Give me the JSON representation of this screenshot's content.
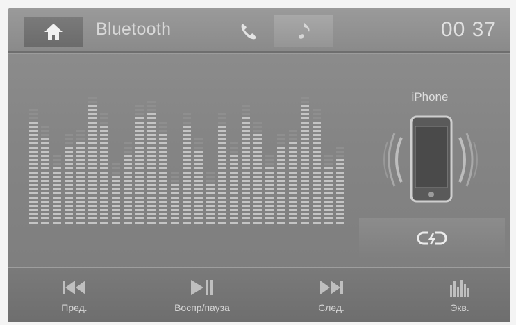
{
  "header": {
    "home_icon": "home-icon",
    "title": "Bluetooth",
    "tabs": [
      {
        "icon": "phone-icon",
        "active": false
      },
      {
        "icon": "music-note-icon",
        "active": true
      }
    ],
    "clock": "00 37"
  },
  "equalizer": {
    "levels": [
      0.82,
      0.68,
      0.45,
      0.6,
      0.65,
      0.93,
      0.78,
      0.4,
      0.56,
      0.83,
      0.86,
      0.7,
      0.32,
      0.76,
      0.59,
      0.31,
      0.76,
      0.55,
      0.84,
      0.72,
      0.46,
      0.62,
      0.66,
      0.94,
      0.81,
      0.44,
      0.52
    ]
  },
  "device": {
    "name": "iPhone",
    "icon": "smartphone-icon",
    "link_icon": "link-icon"
  },
  "footer": {
    "prev_label": "Пред.",
    "play_pause_label": "Воспр/пауза",
    "next_label": "След.",
    "eq_label": "Экв."
  },
  "colors": {
    "text": "#d8d8d8",
    "active_tab": "#a0a0a0"
  }
}
